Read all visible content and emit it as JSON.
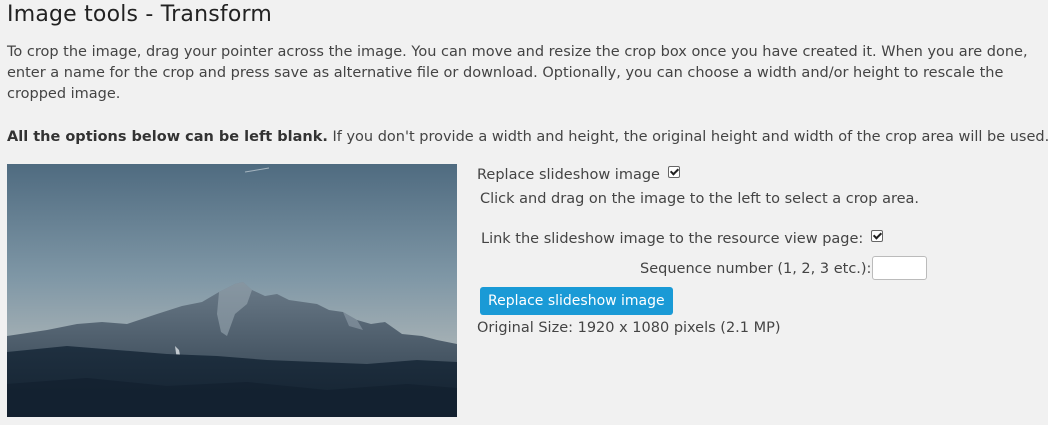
{
  "header": {
    "title": "Image tools - Transform"
  },
  "intro": {
    "text": "To crop the image, drag your pointer across the image. You can move and resize the crop box once you have created it. When you are done, enter a name for the crop and press save as alternative file or download. Optionally, you can choose a width and/or height to rescale the cropped image."
  },
  "options_note": {
    "bold": "All the options below can be left blank.",
    "rest": " If you don't provide a width and height, the original height and width of the crop area will be used."
  },
  "preview": {
    "description_icon": "mountain-photo"
  },
  "panel": {
    "replace_label": "Replace slideshow image",
    "replace_checked": true,
    "crop_hint": "Click and drag on the image to the left to select a crop area.",
    "link_label": "Link the slideshow image to the resource view page:",
    "link_checked": true,
    "sequence_label": "Sequence number (1, 2, 3 etc.):",
    "sequence_value": "",
    "submit_label": "Replace slideshow image",
    "original_size": "Original Size: 1920 x 1080 pixels (2.1 MP)"
  },
  "colors": {
    "button": "#1a9ad6",
    "background": "#f1f1f1"
  }
}
